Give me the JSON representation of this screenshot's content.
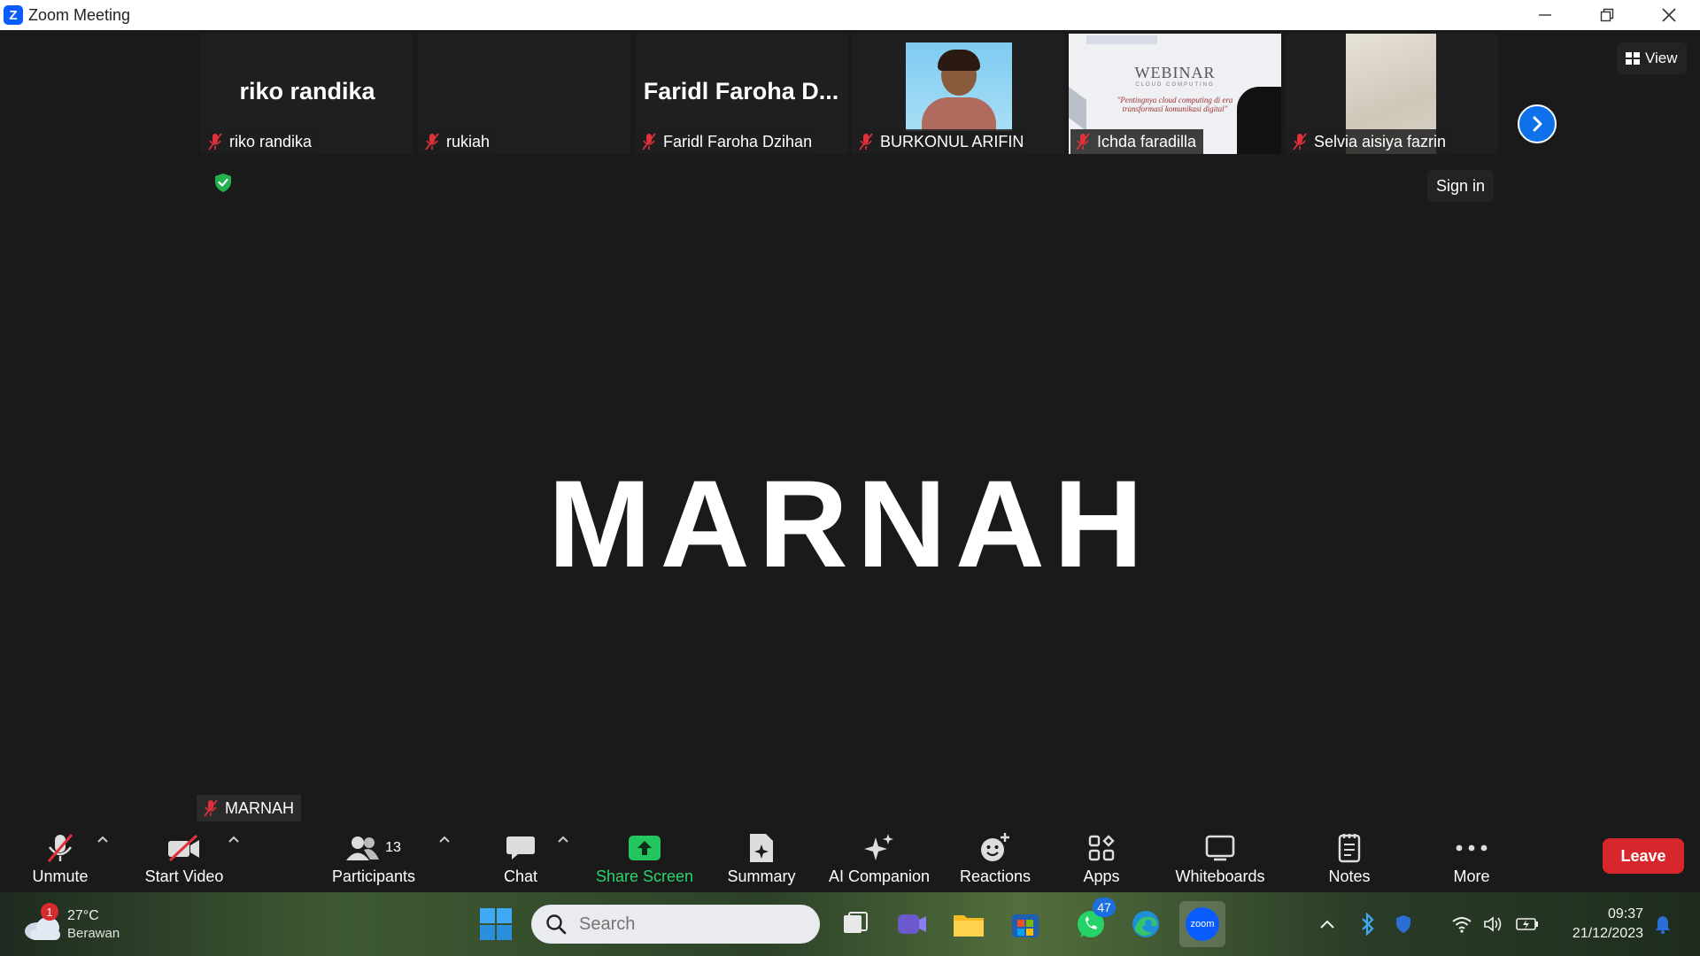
{
  "window": {
    "title": "Zoom Meeting",
    "icon": "zoom-logo-icon"
  },
  "gallery": {
    "tiles": [
      {
        "display_name": "riko randika",
        "label": "riko randika",
        "muted": true,
        "video": false
      },
      {
        "display_name": "",
        "label": "rukiah",
        "muted": true,
        "video": false
      },
      {
        "display_name": "Faridl  Faroha  D...",
        "label": "Faridl Faroha Dzihan",
        "muted": true,
        "video": false
      },
      {
        "display_name": "",
        "label": "BURKONUL ARIFIN",
        "muted": true,
        "video": true
      },
      {
        "display_name": "",
        "label": "Ichda faradilla",
        "muted": true,
        "video": true
      },
      {
        "display_name": "",
        "label": "Selvia aisiya fazrin",
        "muted": true,
        "video": true
      }
    ],
    "webinar_slide": {
      "title": "WEBINAR",
      "subtitle": "CLOUD COMPUTING",
      "tagline": "\"Pentingnya cloud computing di era transformasi komunikasi digital\""
    }
  },
  "header": {
    "view_label": "View",
    "sign_in_label": "Sign in"
  },
  "speaker": {
    "name": "MARNAH",
    "label": "MARNAH"
  },
  "toolbar": {
    "unmute": "Unmute",
    "start_video": "Start Video",
    "participants": "Participants",
    "participant_count": "13",
    "chat": "Chat",
    "share_screen": "Share Screen",
    "summary": "Summary",
    "ai_companion": "AI Companion",
    "reactions": "Reactions",
    "apps": "Apps",
    "whiteboards": "Whiteboards",
    "notes": "Notes",
    "more": "More",
    "leave": "Leave"
  },
  "taskbar": {
    "weather_badge": "1",
    "weather_temp": "27°C",
    "weather_condition": "Berawan",
    "search_placeholder": "Search",
    "whatsapp_badge": "47",
    "zoom_label": "zoom",
    "time": "09:37",
    "date": "21/12/2023"
  },
  "colors": {
    "accent": "#0e71eb",
    "leave": "#d8262d",
    "share_green": "#2ad46b",
    "muted_red": "#e0303a"
  }
}
